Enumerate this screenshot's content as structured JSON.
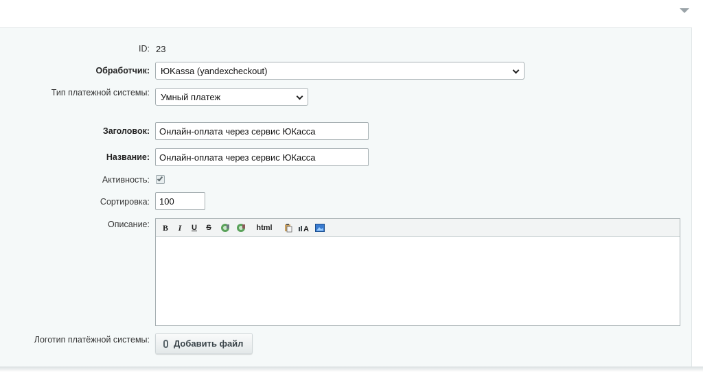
{
  "form": {
    "id_label": "ID:",
    "id_value": "23",
    "handler_label": "Обработчик:",
    "handler_value": "ЮKassa (yandexcheckout)",
    "ps_type_label": "Тип платежной системы:",
    "ps_type_value": "Умный платеж",
    "title_label": "Заголовок:",
    "title_value": "Онлайн-оплата через сервис ЮКасса",
    "name_label": "Название:",
    "name_value": "Онлайн-оплата через сервис ЮКасса",
    "active_label": "Активность:",
    "active_checked": true,
    "sort_label": "Сортировка:",
    "sort_value": "100",
    "description_label": "Описание:",
    "description_value": "",
    "logo_label": "Логотип платёжной системы:",
    "add_file_label": "Добавить файл"
  },
  "editor_toolbar": {
    "bold": "B",
    "italic": "I",
    "underline": "U",
    "strike": "S",
    "html": "html",
    "icons": [
      "insert-link-icon",
      "remove-link-icon",
      "paste-text-icon",
      "font-size-icon",
      "insert-image-icon"
    ]
  },
  "colors": {
    "panel_bg": "#f5f9f9",
    "border": "#a7b0b3",
    "accent": "#3a87c8"
  }
}
